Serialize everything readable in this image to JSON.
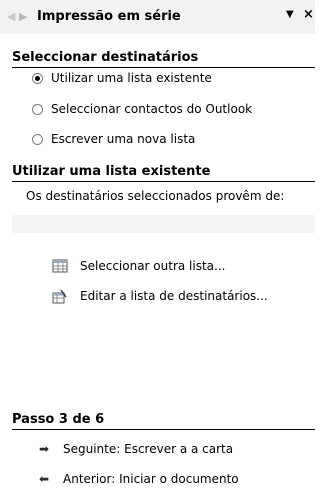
{
  "titlebar": {
    "title": "Impressão em série",
    "back_icon": "◆",
    "fwd_icon": "◆",
    "dropdown": "▼",
    "close": "×"
  },
  "select_recipients": {
    "heading": "Seleccionar destinatários",
    "options": [
      {
        "label": "Utilizar uma lista existente",
        "checked": true
      },
      {
        "label": "Seleccionar contactos do Outlook",
        "checked": false
      },
      {
        "label": "Escrever uma nova lista",
        "checked": false
      }
    ]
  },
  "use_existing": {
    "heading": "Utilizar uma lista existente",
    "description": "Os destinatários seleccionados provêm de:",
    "select_other": "Seleccionar outra lista...",
    "edit_list": "Editar a lista de destinatários..."
  },
  "step": {
    "heading": "Passo 3 de 6",
    "next": "Seguinte: Escrever a a carta",
    "previous": "Anterior: Iniciar o documento"
  }
}
